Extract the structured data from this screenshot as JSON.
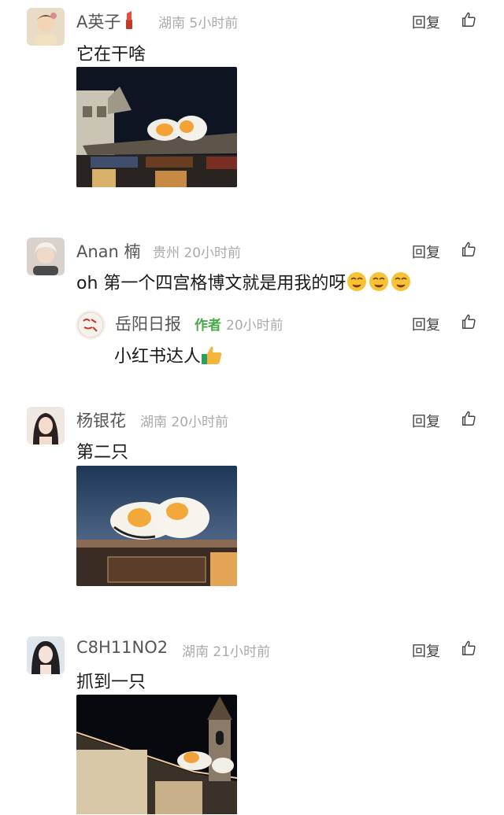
{
  "comments": [
    {
      "user": "A英子",
      "location": "湖南",
      "time": "5小时前",
      "reply_label": "回复",
      "text": "它在干啥",
      "has_image": true
    },
    {
      "user": "Anan 楠",
      "location": "贵州",
      "time": "20小时前",
      "reply_label": "回复",
      "text": "oh 第一个四宫格博文就是用我的呀",
      "replies": [
        {
          "user": "岳阳日报",
          "author_tag": "作者",
          "time": "20小时前",
          "reply_label": "回复",
          "text": "小红书达人"
        }
      ]
    },
    {
      "user": "杨银花",
      "location": "湖南",
      "time": "20小时前",
      "reply_label": "回复",
      "text": "第二只",
      "has_image": true
    },
    {
      "user": "C8H11NO2",
      "location": "湖南",
      "time": "21小时前",
      "reply_label": "回复",
      "text": "抓到一只",
      "has_image": true
    }
  ],
  "icons": {
    "like": "thumbs-up-outline-icon",
    "emoji": "drooling-face-emoji",
    "thumbs_emoji": "thumbs-up-emoji",
    "lipstick": "lipstick-emoji"
  },
  "colors": {
    "author_tag": "#4aa84a",
    "meta": "#aaaaaa"
  }
}
